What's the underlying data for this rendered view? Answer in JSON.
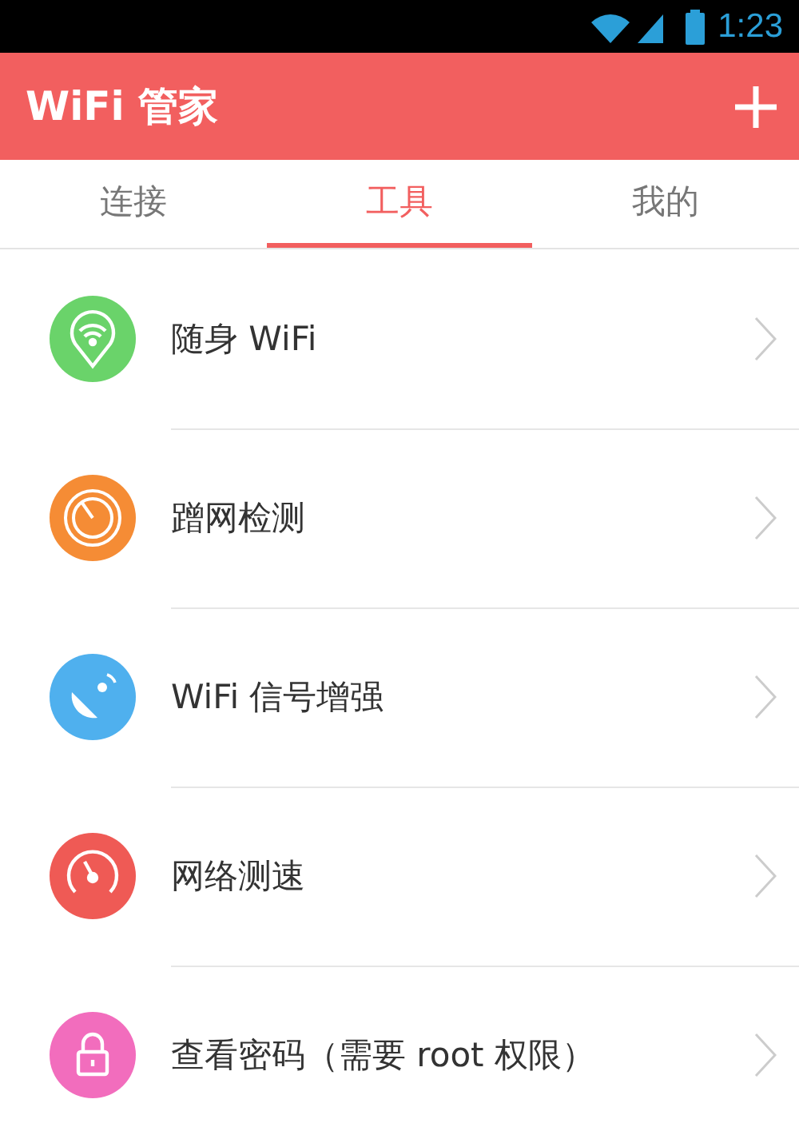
{
  "status_bar": {
    "time": "1:23"
  },
  "app_bar": {
    "title": "WiFi 管家"
  },
  "tabs": [
    {
      "label": "连接",
      "selected": false
    },
    {
      "label": "工具",
      "selected": true
    },
    {
      "label": "我的",
      "selected": false
    }
  ],
  "tools": [
    {
      "kind": "wifi-pin",
      "label": "随身 WiFi",
      "color": "#6ad36a"
    },
    {
      "kind": "radar",
      "label": "蹭网检测",
      "color": "#f58c35"
    },
    {
      "kind": "dish",
      "label": "WiFi 信号增强",
      "color": "#4fb0ee"
    },
    {
      "kind": "gauge",
      "label": "网络测速",
      "color": "#ef5a55"
    },
    {
      "kind": "lock",
      "label": "查看密码（需要 root 权限）",
      "color": "#f26dbd"
    }
  ]
}
